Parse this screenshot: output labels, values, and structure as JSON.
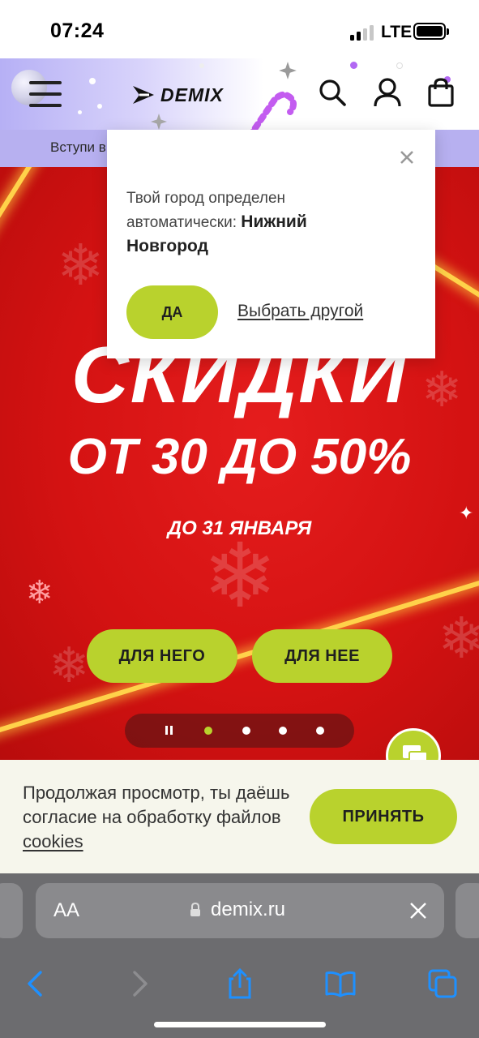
{
  "status_bar": {
    "time": "07:24",
    "network": "LTE"
  },
  "header": {
    "logo_text": "DEMIX",
    "icons": [
      "menu-icon",
      "search-icon",
      "profile-icon",
      "cart-icon"
    ]
  },
  "promo_strip": {
    "text": "Вступи в"
  },
  "banner": {
    "headline": "СКИДКИ",
    "subheadline": "ОТ 30 ДО 50%",
    "date_line": "ДО 31 ЯНВАРЯ",
    "buttons": [
      "ДЛЯ НЕГО",
      "ДЛЯ НЕЕ"
    ],
    "slides_count": 4,
    "active_slide": 1
  },
  "city_popup": {
    "text": "Твой город определен автоматически:",
    "city": "Нижний Новгород",
    "confirm_label": "ДА",
    "choose_other_label": "Выбрать другой"
  },
  "cookies": {
    "text": "Продолжая просмотр, ты даёшь согласие на обработку файлов",
    "link_text": "cookies",
    "accept_label": "ПРИНЯТЬ"
  },
  "browser": {
    "text_size_label": "AA",
    "url": "demix.ru"
  },
  "colors": {
    "accent_lime": "#b9d22d",
    "banner_red": "#d41212",
    "header_lavender": "#b7b0f0",
    "toolbar_gray": "#6c6c6f",
    "ios_blue": "#1e90ff"
  }
}
